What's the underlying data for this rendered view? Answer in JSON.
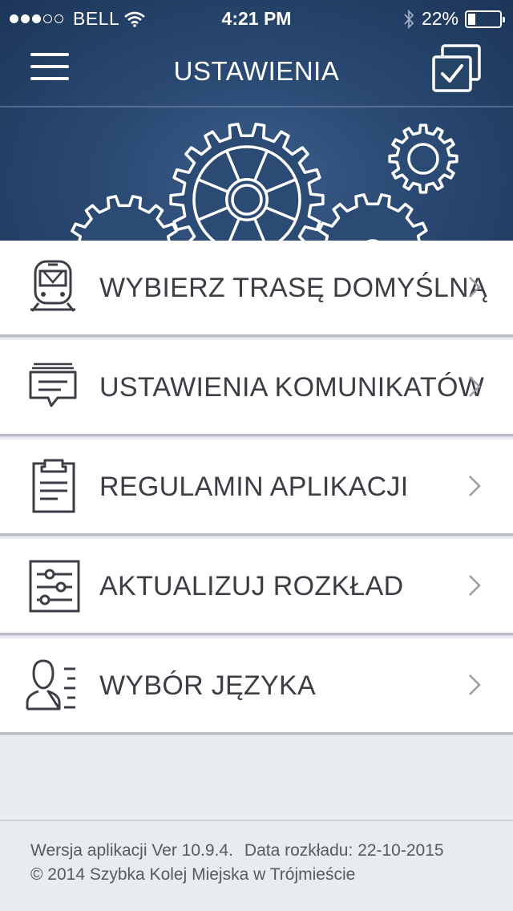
{
  "status_bar": {
    "carrier": "BELL",
    "time": "4:21 PM",
    "battery_percent": "22%",
    "battery_level": 0.22,
    "signal_bars": 3,
    "signal_total": 5,
    "icons": [
      "wifi-icon",
      "bluetooth-icon",
      "battery-icon"
    ]
  },
  "navbar": {
    "title": "USTAWIENIA",
    "left_icon": "hamburger-menu-icon",
    "right_icon": "checklist-icon"
  },
  "menu": {
    "items": [
      {
        "label": "WYBIERZ TRASĘ DOMYŚLNĄ",
        "icon": "train-icon"
      },
      {
        "label": "USTAWIENIA KOMUNIKATÓW",
        "icon": "messages-icon"
      },
      {
        "label": "REGULAMIN APLIKACJI",
        "icon": "clipboard-icon"
      },
      {
        "label": "AKTUALIZUJ ROZKŁAD",
        "icon": "sliders-icon"
      },
      {
        "label": "WYBÓR JĘZYKA",
        "icon": "user-language-icon"
      }
    ]
  },
  "footer": {
    "version": "Wersja aplikacji Ver 10.9.4.",
    "schedule_date": "Data rozkładu: 22-10-2015",
    "copyright": "© 2014 Szybka Kolej Miejska w Trójmieście"
  },
  "colors": {
    "header_dark": "#1c3658",
    "header_light": "#3d5f8c",
    "item_text": "#3b3f45",
    "background": "#e8ebef"
  }
}
